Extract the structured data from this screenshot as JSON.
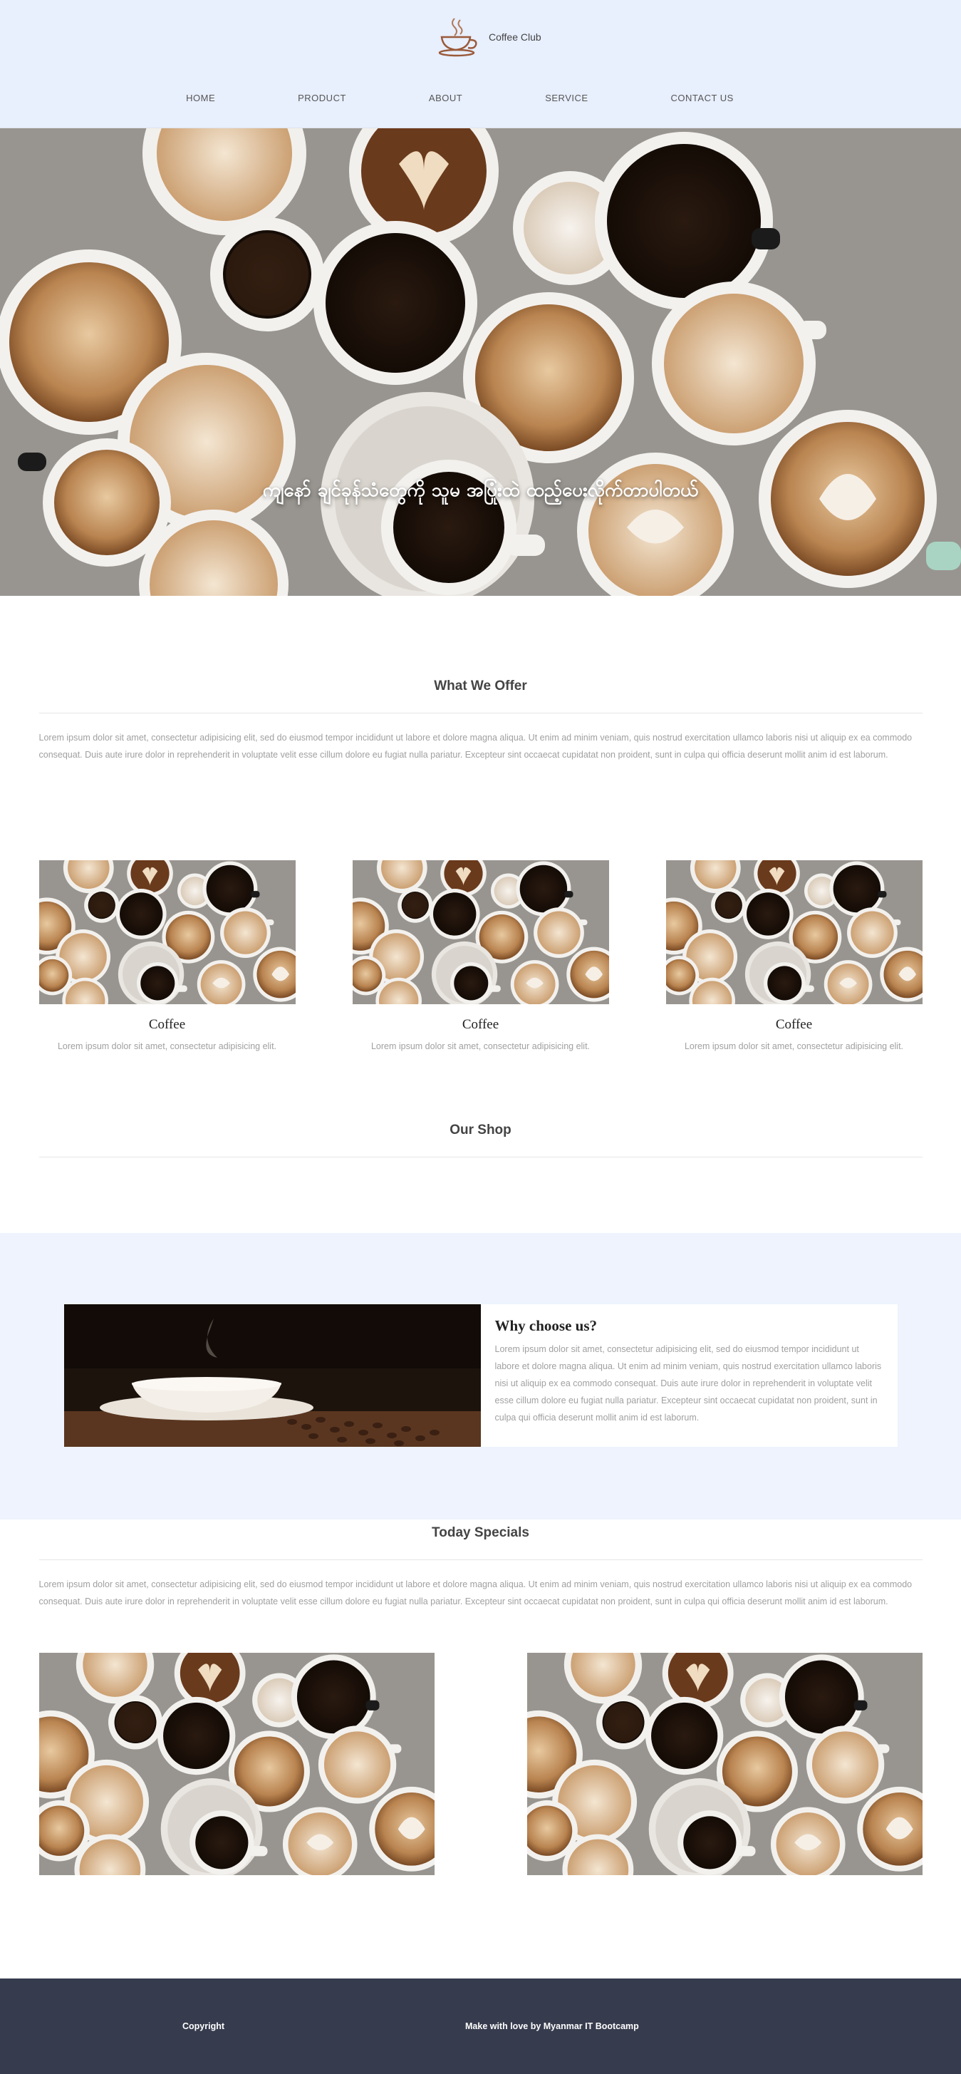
{
  "brand": {
    "name": "Coffee Club",
    "icon": "coffee-cup-icon"
  },
  "nav": {
    "items": [
      "HOME",
      "PRODUCT",
      "ABOUT",
      "SERVICE",
      "CONTACT US"
    ]
  },
  "hero": {
    "caption": "ကျနော် ချင်ခုန်သံတွေကို သူမ အပြုံးထဲ ထည့်ပေးလိုက်တာပါတယ်"
  },
  "offer": {
    "title": "What We Offer",
    "text": "Lorem ipsum dolor sit amet, consectetur adipisicing elit, sed do eiusmod tempor incididunt ut labore et dolore magna aliqua. Ut enim ad minim veniam, quis nostrud exercitation ullamco laboris nisi ut aliquip ex ea commodo consequat. Duis aute irure dolor in reprehenderit in voluptate velit esse cillum dolore eu fugiat nulla pariatur. Excepteur sint occaecat cupidatat non proident, sunt in culpa qui officia deserunt mollit anim id est laborum."
  },
  "cards": [
    {
      "title": "Coffee",
      "text": "Lorem ipsum dolor sit amet, consectetur adipisicing elit."
    },
    {
      "title": "Coffee",
      "text": "Lorem ipsum dolor sit amet, consectetur adipisicing elit."
    },
    {
      "title": "Coffee",
      "text": "Lorem ipsum dolor sit amet, consectetur adipisicing elit."
    }
  ],
  "shop": {
    "title": "Our Shop"
  },
  "why": {
    "title": "Why choose us?",
    "text": "Lorem ipsum dolor sit amet, consectetur adipisicing elit, sed do eiusmod tempor incididunt ut labore et dolore magna aliqua. Ut enim ad minim veniam, quis nostrud exercitation ullamco laboris nisi ut aliquip ex ea commodo consequat. Duis aute irure dolor in reprehenderit in voluptate velit esse cillum dolore eu fugiat nulla pariatur. Excepteur sint occaecat cupidatat non proident, sunt in culpa qui officia deserunt mollit anim id est laborum."
  },
  "specials": {
    "title": "Today Specials",
    "text": "Lorem ipsum dolor sit amet, consectetur adipisicing elit, sed do eiusmod tempor incididunt ut labore et dolore magna aliqua. Ut enim ad minim veniam, quis nostrud exercitation ullamco laboris nisi ut aliquip ex ea commodo consequat. Duis aute irure dolor in reprehenderit in voluptate velit esse cillum dolore eu fugiat nulla pariatur. Excepteur sint occaecat cupidatat non proident, sunt in culpa qui officia deserunt mollit anim id est laborum."
  },
  "footer": {
    "copyright": "Copyright",
    "credit": "Make with love by Myanmar IT Bootcamp"
  },
  "colors": {
    "header_bg": "#e8effd",
    "why_bg": "#eef3fd",
    "footer_bg": "#363b4d",
    "muted_text": "#a0a0a0"
  }
}
